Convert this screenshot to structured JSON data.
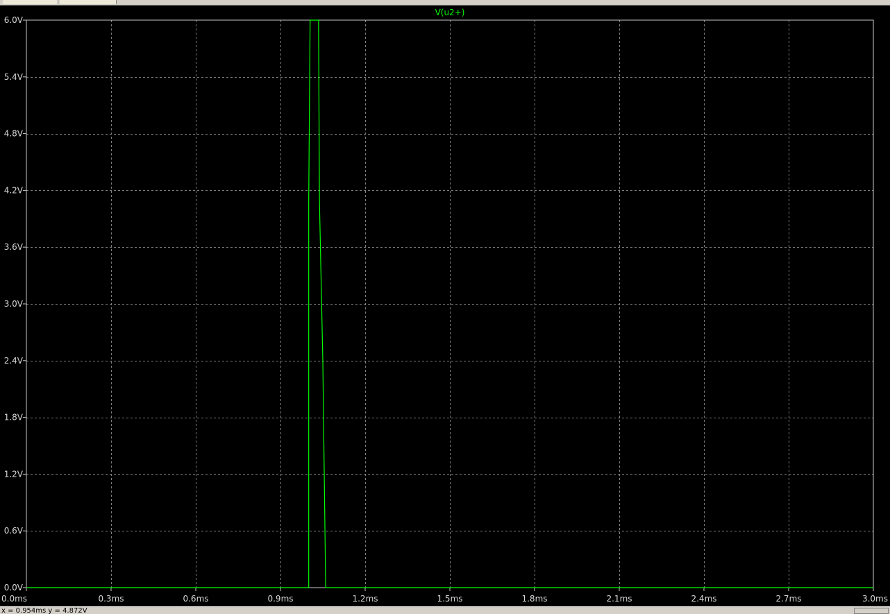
{
  "status": {
    "cursor_readout": "x = 0.954ms   y = 4.872V"
  },
  "colors": {
    "background": "#000000",
    "frame": "#c8c8c8",
    "grid": "#808080",
    "tick_text": "#d8d8d8",
    "trace": "#00ff00"
  },
  "chart_data": {
    "type": "line",
    "title": "",
    "xlabel": "",
    "ylabel": "",
    "xlim": [
      0,
      3.0
    ],
    "ylim": [
      0,
      6.0
    ],
    "grid": true,
    "x_ticks": [
      0,
      0.3,
      0.6,
      0.9,
      1.2,
      1.5,
      1.8,
      2.1,
      2.4,
      2.7,
      3.0
    ],
    "x_tick_labels": [
      "0.0ms",
      "0.3ms",
      "0.6ms",
      "0.9ms",
      "1.2ms",
      "1.5ms",
      "1.8ms",
      "2.1ms",
      "2.4ms",
      "2.7ms",
      "3.0ms"
    ],
    "y_ticks": [
      0,
      0.6,
      1.2,
      1.8,
      2.4,
      3.0,
      3.6,
      4.2,
      4.8,
      5.4,
      6.0
    ],
    "y_tick_labels": [
      "0.0V",
      "0.6V",
      "1.2V",
      "1.8V",
      "2.4V",
      "3.0V",
      "3.6V",
      "4.2V",
      "4.8V",
      "5.4V",
      "6.0V"
    ],
    "series": [
      {
        "name": "V(u2+)",
        "color": "#00ff00",
        "x": [
          0,
          1.0,
          1.0,
          1.0,
          1.005,
          1.035,
          1.038,
          1.05,
          1.06,
          1.062,
          3.0
        ],
        "y": [
          0,
          0,
          4.1,
          4.1,
          6.0,
          6.0,
          4.1,
          2.4,
          0,
          0,
          0
        ]
      }
    ]
  }
}
